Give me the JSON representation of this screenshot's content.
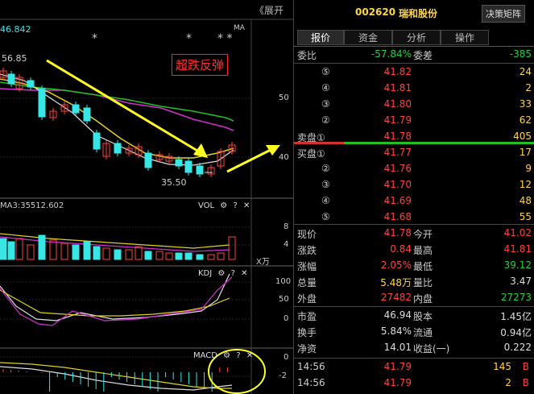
{
  "chart": {
    "expand_label": "《展开",
    "ma_readout": "46.842",
    "ma_label": "MA",
    "annotation": "超跌反弹",
    "high_price_label": "56.85",
    "low_price_label": "35.50",
    "price_axis": [
      "50",
      "40"
    ],
    "vol_readout": "MA3:35512.602",
    "vol_title": "VOL",
    "vol_axis": [
      "8",
      "4"
    ],
    "vol_unit": "X万",
    "kdj_title": "KDJ",
    "kdj_axis": [
      "100",
      "50",
      "0"
    ],
    "macd_title": "MACD",
    "macd_axis": [
      "0",
      "-2"
    ],
    "stars": [
      "*",
      "*",
      "* *"
    ],
    "gear_icon": "⚙",
    "help_icon": "?",
    "close_icon": "✕"
  },
  "header": {
    "code": "002620",
    "name": "瑞和股份",
    "matrix_button": "决策矩阵"
  },
  "tabs": [
    "报价",
    "资金",
    "分析",
    "操作"
  ],
  "ratio": {
    "wb_label": "委比",
    "wb_value": "-57.84%",
    "wc_label": "委差",
    "wc_value": "-385"
  },
  "asks": [
    {
      "label": "⑤",
      "price": "41.82",
      "vol": "24"
    },
    {
      "label": "④",
      "price": "41.81",
      "vol": "2"
    },
    {
      "label": "③",
      "price": "41.80",
      "vol": "33"
    },
    {
      "label": "②",
      "price": "41.79",
      "vol": "62"
    },
    {
      "label": "卖盘①",
      "price": "41.78",
      "vol": "405"
    }
  ],
  "bids": [
    {
      "label": "买盘①",
      "price": "41.77",
      "vol": "17"
    },
    {
      "label": "②",
      "price": "41.76",
      "vol": "9"
    },
    {
      "label": "③",
      "price": "41.70",
      "vol": "12"
    },
    {
      "label": "④",
      "price": "41.69",
      "vol": "48"
    },
    {
      "label": "⑤",
      "price": "41.68",
      "vol": "55"
    }
  ],
  "quote": [
    {
      "l1": "现价",
      "v1": "41.78",
      "c1": "red",
      "l2": "今开",
      "v2": "41.02",
      "c2": "red"
    },
    {
      "l1": "涨跌",
      "v1": "0.84",
      "c1": "red",
      "l2": "最高",
      "v2": "41.81",
      "c2": "red"
    },
    {
      "l1": "涨幅",
      "v1": "2.05%",
      "c1": "red",
      "l2": "最低",
      "v2": "39.12",
      "c2": "grn"
    },
    {
      "l1": "总量",
      "v1": "5.48万",
      "c1": "yel",
      "l2": "量比",
      "v2": "3.47",
      "c2": "wht"
    },
    {
      "l1": "外盘",
      "v1": "27482",
      "c1": "red",
      "l2": "内盘",
      "v2": "27273",
      "c2": "grn"
    }
  ],
  "fundamentals": [
    {
      "l1": "市盈",
      "v1": "46.94",
      "l2": "股本",
      "v2": "1.45亿"
    },
    {
      "l1": "换手",
      "v1": "5.84%",
      "l2": "流通",
      "v2": "0.94亿"
    },
    {
      "l1": "净资",
      "v1": "14.01",
      "l2": "收益(一)",
      "v2": "0.222"
    }
  ],
  "trades": [
    {
      "time": "14:56",
      "price": "41.79",
      "vol": "145",
      "dir": "B"
    },
    {
      "time": "14:56",
      "price": "41.79",
      "vol": "2",
      "dir": "B"
    }
  ],
  "colors": {
    "up": "#ff4040",
    "down": "#20d040",
    "cyan": "#39e6e6",
    "yellow": "#ffd54a",
    "arrow": "#ffff20"
  }
}
